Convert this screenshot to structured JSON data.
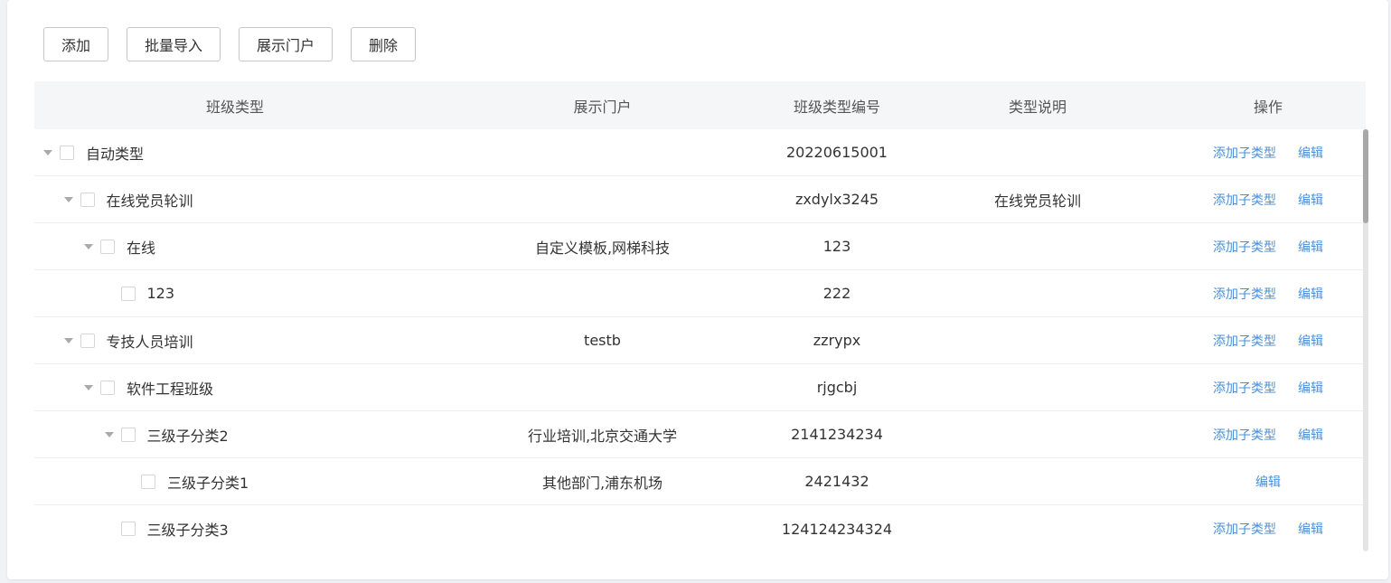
{
  "toolbar": {
    "add_label": "添加",
    "import_label": "批量导入",
    "portal_label": "展示门户",
    "delete_label": "删除"
  },
  "table": {
    "headers": [
      "班级类型",
      "展示门户",
      "班级类型编号",
      "类型说明",
      "操作"
    ],
    "action_add_child": "添加子类型",
    "action_edit": "编辑",
    "rows": [
      {
        "name": "自动类型",
        "portal": "",
        "code": "20220615001",
        "desc": "",
        "level": 0,
        "expandable": true,
        "add_child": true
      },
      {
        "name": "在线党员轮训",
        "portal": "",
        "code": "zxdylx3245",
        "desc": "在线党员轮训",
        "level": 1,
        "expandable": true,
        "add_child": true
      },
      {
        "name": "在线",
        "portal": "自定义模板,网梯科技",
        "code": "123",
        "desc": "",
        "level": 2,
        "expandable": true,
        "add_child": true
      },
      {
        "name": "123",
        "portal": "",
        "code": "222",
        "desc": "",
        "level": 3,
        "expandable": false,
        "add_child": true
      },
      {
        "name": "专技人员培训",
        "portal": "testb",
        "code": "zzrypx",
        "desc": "",
        "level": 1,
        "expandable": true,
        "add_child": true
      },
      {
        "name": "软件工程班级",
        "portal": "",
        "code": "rjgcbj",
        "desc": "",
        "level": 2,
        "expandable": true,
        "add_child": true
      },
      {
        "name": "三级子分类2",
        "portal": "行业培训,北京交通大学",
        "code": "2141234234",
        "desc": "",
        "level": 3,
        "expandable": true,
        "add_child": true
      },
      {
        "name": "三级子分类1",
        "portal": "其他部门,浦东机场",
        "code": "2421432",
        "desc": "",
        "level": 4,
        "expandable": false,
        "add_child": false
      },
      {
        "name": "三级子分类3",
        "portal": "",
        "code": "124124234324",
        "desc": "",
        "level": 3,
        "expandable": false,
        "add_child": true
      }
    ]
  },
  "colors": {
    "link": "#4a90d9",
    "header_bg": "#f5f6f7",
    "border": "#ebeef5"
  }
}
